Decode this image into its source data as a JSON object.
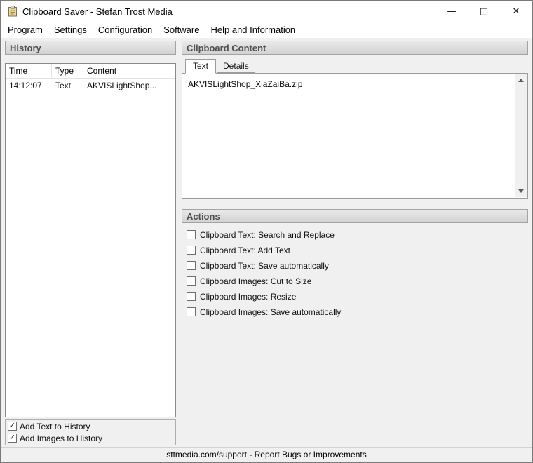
{
  "window": {
    "title": "Clipboard Saver - Stefan Trost Media",
    "controls": {
      "minimize": "—",
      "maximize": "□",
      "close": "✕"
    }
  },
  "menu": {
    "items": [
      "Program",
      "Settings",
      "Configuration",
      "Software",
      "Help and Information"
    ]
  },
  "history": {
    "title": "History",
    "table": {
      "columns": [
        "Time",
        "Type",
        "Content"
      ],
      "rows": [
        {
          "time": "14:12:07",
          "type": "Text",
          "content": "AKVISLightShop..."
        }
      ]
    },
    "options": [
      {
        "label": "Add Text to History",
        "checked": true
      },
      {
        "label": "Add Images to History",
        "checked": true
      }
    ]
  },
  "clipboard_content": {
    "title": "Clipboard Content",
    "tabs": [
      {
        "label": "Text",
        "active": true
      },
      {
        "label": "Details",
        "active": false
      }
    ],
    "text": "AKVISLightShop_XiaZaiBa.zip"
  },
  "actions": {
    "title": "Actions",
    "items": [
      {
        "label": "Clipboard Text: Search and Replace",
        "checked": false
      },
      {
        "label": "Clipboard Text: Add Text",
        "checked": false
      },
      {
        "label": "Clipboard Text: Save automatically",
        "checked": false
      },
      {
        "label": "Clipboard Images: Cut to Size",
        "checked": false
      },
      {
        "label": "Clipboard Images: Resize",
        "checked": false
      },
      {
        "label": "Clipboard Images: Save automatically",
        "checked": false
      }
    ]
  },
  "status_bar": {
    "text": "sttmedia.com/support - Report Bugs or Improvements"
  },
  "colors": {
    "window_bg": "#f0f0f0",
    "titlebar_bg": "#ffffff",
    "header_bg_top": "#e9e9e9",
    "header_bg_bottom": "#d2d2d2"
  }
}
